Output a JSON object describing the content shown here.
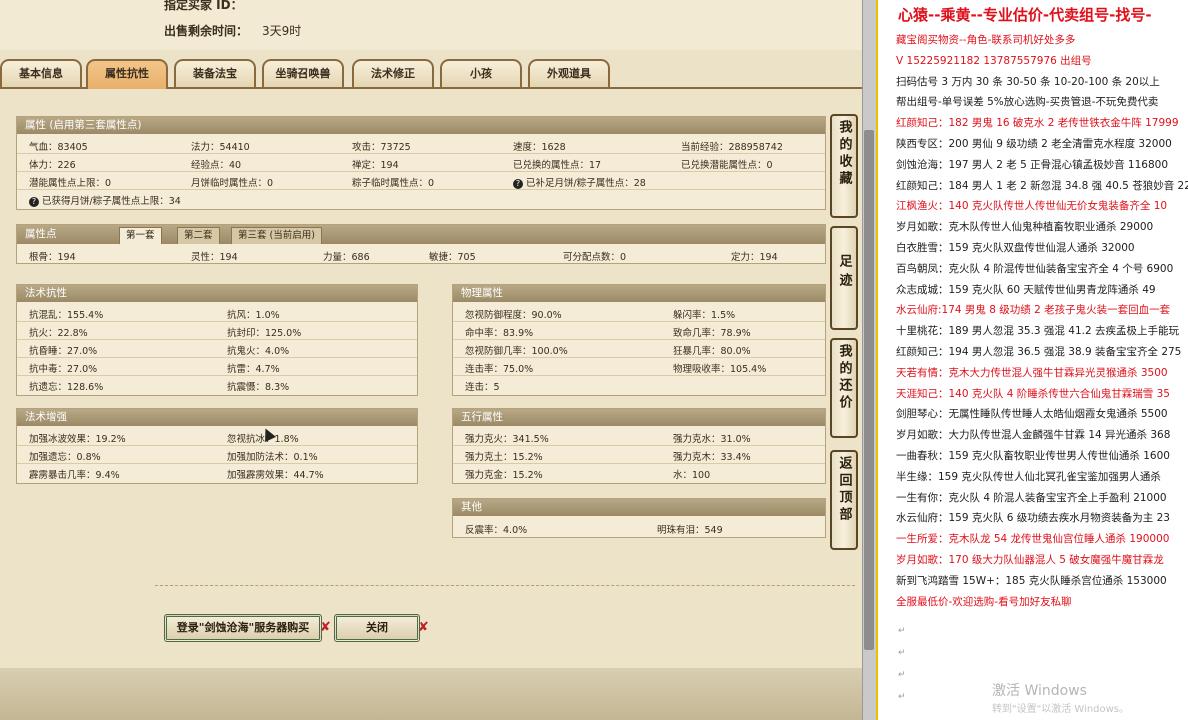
{
  "seller": {
    "label1": "指定买家 ID：",
    "time_label": "出售剩余时间：",
    "time_value": "3天9时"
  },
  "tabs": [
    "基本信息",
    "属性抗性",
    "装备法宝",
    "坐骑召唤兽",
    "法术修正",
    "小孩",
    "外观道具"
  ],
  "attr": {
    "title": "属性 (启用第三套属性点)",
    "rows": [
      [
        "气血：83405",
        "法力：54410",
        "攻击：73725",
        "速度：1628",
        "当前经验：288958742"
      ],
      [
        "体力：226",
        "经验点：40",
        "禅定：194",
        "已兑换的属性点：17",
        "已兑换潜能属性点：0"
      ],
      [
        "潜能属性点上限：0",
        "月饼临时属性点：0",
        "粽子临时属性点：0",
        "已补足月饼/粽子属性点：28",
        ""
      ],
      [
        "已获得月饼/粽子属性点上限：34",
        "",
        "",
        "",
        ""
      ]
    ]
  },
  "points": {
    "title": "属性点",
    "subtabs": [
      "第一套",
      "第二套",
      "第三套 (当前启用)"
    ],
    "values": [
      "根骨：194",
      "灵性：194",
      "力量：686",
      "敏捷：705",
      "可分配点数：0",
      "定力：194"
    ]
  },
  "magic_res": {
    "title": "法术抗性",
    "rows": [
      [
        "抗混乱：155.4%",
        "抗风：1.0%"
      ],
      [
        "抗火：22.8%",
        "抗封印：125.0%"
      ],
      [
        "抗昏睡：27.0%",
        "抗鬼火：4.0%"
      ],
      [
        "抗中毒：27.0%",
        "抗雷：4.7%"
      ],
      [
        "抗遗忘：128.6%",
        "抗震慑：8.3%"
      ]
    ]
  },
  "physical": {
    "title": "物理属性",
    "rows": [
      [
        "忽视防御程度：90.0%",
        "躲闪率：1.5%"
      ],
      [
        "命中率：83.9%",
        "致命几率：78.9%"
      ],
      [
        "忽视防御几率：100.0%",
        "狂暴几率：80.0%"
      ],
      [
        "连击率：75.0%",
        "物理吸收率：105.4%"
      ],
      [
        "连击：5",
        ""
      ]
    ]
  },
  "magic_boost": {
    "title": "法术增强",
    "rows": [
      [
        "加强冰波效果：19.2%",
        "忽视抗冰：1.8%"
      ],
      [
        "加强遗忘：0.8%",
        "加强加防法术：0.1%"
      ],
      [
        "霹雳暴击几率：9.4%",
        "加强霹雳效果：44.7%"
      ]
    ]
  },
  "wuxing": {
    "title": "五行属性",
    "rows": [
      [
        "强力克火：341.5%",
        "强力克水：31.0%"
      ],
      [
        "强力克土：15.2%",
        "强力克木：33.4%"
      ],
      [
        "强力克金：15.2%",
        "水：100"
      ]
    ]
  },
  "other": {
    "title": "其他",
    "values": [
      "反震率：4.0%",
      "明珠有泪：549"
    ]
  },
  "side_buttons": [
    "我的收藏",
    "足迹",
    "我的还价",
    "返回顶部"
  ],
  "bottom_buttons": {
    "login": "登录\"剑蚀沧海\"服务器购买",
    "close": "关闭"
  },
  "doc": {
    "title": "心猿--乘黄--专业估价-代卖组号-找号-",
    "lines": [
      {
        "t": "藏宝阁买物资--角色-联系司机好处多多",
        "red": true
      },
      {
        "t": "V 15225921182  13787557976  出组号",
        "red": true
      },
      {
        "t": "扫码估号 3 万内 30 条 30-50 条 10-20-100 条 20以上",
        "red": false
      },
      {
        "t": "帮出组号-单号误差 5%放心选购-买贵管退-不玩免费代卖",
        "red": false
      },
      {
        "t": "红颜知己：182 男鬼 16 破克水 2 老传世铁衣金牛阵 17999",
        "red": true
      },
      {
        "t": "陕西专区：200 男仙 9 级功绩 2 老全清雷克水程度 32000",
        "red": false
      },
      {
        "t": "剑蚀沧海：197 男人 2 老 5 正骨混心镇孟极妙音 116800",
        "red": false
      },
      {
        "t": "红颜知己：184 男人 1 老 2 新忽混 34.8 强 40.5 苍狼妙音 22",
        "red": false
      },
      {
        "t": "江枫渔火：140 克火队传世人传世仙无价女鬼装备齐全 10",
        "red": true
      },
      {
        "t": "岁月如歌：克木队传世人仙鬼种植畜牧职业通杀 29000",
        "red": false
      },
      {
        "t": "白衣胜雪：159 克火队双盘传世仙混人通杀 32000",
        "red": false
      },
      {
        "t": "百鸟朝凤：克火队 4 阶混传世仙装备宝宝齐全 4 个号 6900",
        "red": false
      },
      {
        "t": "众志成城：159 克火队 60 天赋传世仙男青龙阵通杀 49",
        "red": false
      },
      {
        "t": "水云仙府:174 男鬼 8 级功绩 2 老孩子鬼火装一套回血一套",
        "red": true
      },
      {
        "t": "十里桃花：189 男人忽混 35.3 强混 41.2 去疾孟极上手能玩",
        "red": false
      },
      {
        "t": "红颜知己：194 男人忽混 36.5 强混 38.9 装备宝宝齐全 275",
        "red": false
      },
      {
        "t": "天若有情：克木大力传世混人强牛甘霖异光灵猴通杀 3500",
        "red": true
      },
      {
        "t": "天涯知己：140 克火队 4 阶睡杀传世六合仙鬼甘霖瑞雪 35",
        "red": true
      },
      {
        "t": "剑胆琴心：无属性睡队传世睡人太皓仙烟霞女鬼通杀 5500",
        "red": false
      },
      {
        "t": "岁月如歌：大力队传世混人金麟强牛甘霖 14 异光通杀 368",
        "red": false
      },
      {
        "t": "一曲春秋：159 克火队畜牧职业传世男人传世仙通杀 1600",
        "red": false
      },
      {
        "t": "半生缘：159 克火队传世人仙北冥孔雀宝鉴加强男人通杀",
        "red": false
      },
      {
        "t": "一生有你：克火队 4 阶混人装备宝宝齐全上手盈利 21000",
        "red": false
      },
      {
        "t": "水云仙府：159 克火队 6 级功绩去疾水月物资装备为主 23",
        "red": false
      },
      {
        "t": "一生所爱：克木队龙 54 龙传世鬼仙宫位睡人通杀 190000",
        "red": true
      },
      {
        "t": "岁月如歌：170 级大力队仙器混人 5 破女魔强牛魔甘霖龙",
        "red": true
      },
      {
        "t": "新到飞鸿踏雪 15W+：185 克火队睡杀宫位通杀 153000",
        "red": false
      },
      {
        "t": "全服最低价-欢迎选购-看号加好友私聊",
        "red": true
      }
    ],
    "watermark_title": "激活 Windows",
    "watermark_sub": "转到\"设置\"以激活 Windows。"
  }
}
